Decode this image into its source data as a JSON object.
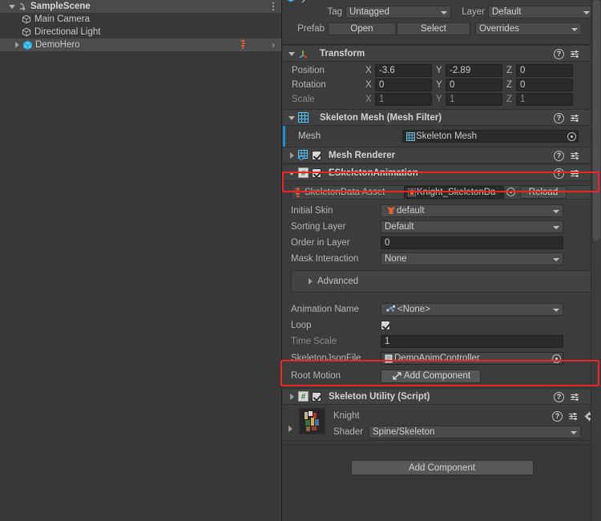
{
  "hierarchy": {
    "rows": [
      {
        "label": "SampleScene",
        "icon": "scene-icon",
        "indent": 6,
        "expanded": true,
        "selected": false,
        "kind": "scene"
      },
      {
        "label": "Main Camera",
        "icon": "gameobject-icon",
        "indent": 22,
        "expanded": null,
        "selected": false,
        "kind": "object"
      },
      {
        "label": "Directional Light",
        "icon": "gameobject-icon",
        "indent": 22,
        "expanded": null,
        "selected": false,
        "kind": "object"
      },
      {
        "label": "DemoHero",
        "icon": "prefab-cube-icon",
        "indent": 12,
        "expanded": false,
        "selected": true,
        "kind": "prefab"
      }
    ],
    "kebab_label": "more-menu"
  },
  "inspector": {
    "tag": {
      "label": "Tag",
      "value": "Untagged"
    },
    "layer": {
      "label": "Layer",
      "value": "Default"
    },
    "prefab": {
      "label": "Prefab",
      "open_label": "Open",
      "select_label": "Select",
      "overrides_label": "Overrides"
    },
    "transform": {
      "title": "Transform",
      "rows": [
        {
          "label": "Position",
          "x": "-3.6",
          "y": "-2.89",
          "z": "0",
          "dim": false
        },
        {
          "label": "Rotation",
          "x": "0",
          "y": "0",
          "z": "0",
          "dim": false
        },
        {
          "label": "Scale",
          "x": "1",
          "y": "1",
          "z": "1",
          "dim": true
        }
      ],
      "axis": [
        "X",
        "Y",
        "Z"
      ]
    },
    "mesh_filter": {
      "title": "Skeleton Mesh (Mesh Filter)",
      "mesh_label": "Mesh",
      "mesh_value": "Skeleton Mesh"
    },
    "mesh_renderer": {
      "title": "Mesh Renderer",
      "enabled": true
    },
    "skeleton_animation": {
      "title": "ESkeletonAnimation",
      "enabled": true,
      "skeleton_data_label": "SkeletonData Asset",
      "skeleton_data_value": "Knight_SkeletonDa",
      "reload_label": "Reload",
      "initial_skin_label": "Initial Skin",
      "initial_skin_value": "default",
      "sorting_layer_label": "Sorting Layer",
      "sorting_layer_value": "Default",
      "order_in_layer_label": "Order in Layer",
      "order_in_layer_value": "0",
      "mask_interaction_label": "Mask Interaction",
      "mask_interaction_value": "None",
      "advanced_label": "Advanced",
      "animation_name_label": "Animation Name",
      "animation_name_value": "<None>",
      "loop_label": "Loop",
      "loop_checked": true,
      "time_scale_label": "Time Scale",
      "time_scale_value": "1",
      "skeleton_json_label": "SkeletonJsonFile",
      "skeleton_json_value": "DemoAnimController",
      "root_motion_label": "Root Motion",
      "root_motion_button": "Add Component"
    },
    "skeleton_utility": {
      "title": "Skeleton Utility (Script)",
      "enabled": true,
      "material_name": "Knight",
      "shader_label": "Shader",
      "shader_value": "Spine/Skeleton"
    },
    "add_component_label": "Add Component"
  },
  "highlights": [
    {
      "name": "eskeletonanimation-header-highlight",
      "color": "#ec2327"
    },
    {
      "name": "skeletonjsonfile-row-highlight",
      "color": "#ec2327"
    }
  ]
}
